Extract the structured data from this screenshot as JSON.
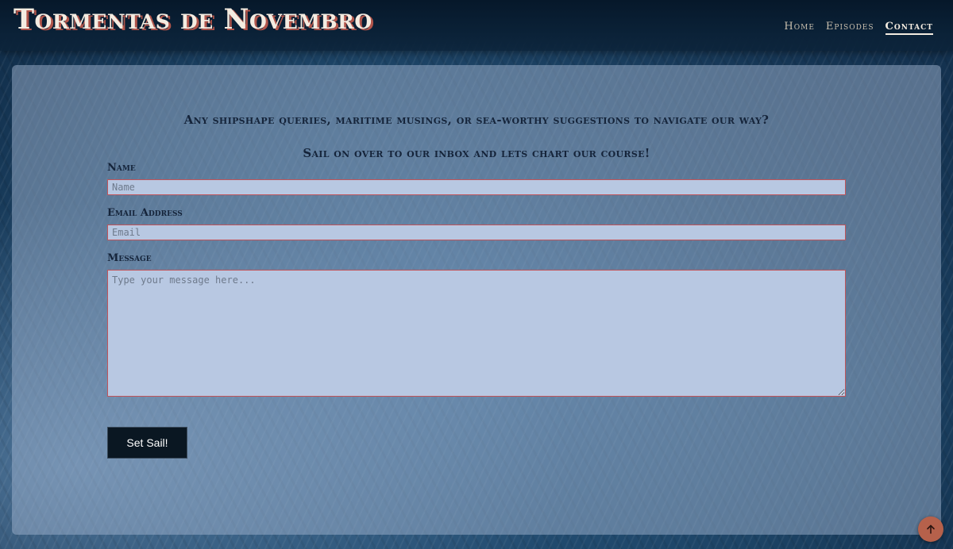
{
  "header": {
    "site_title": "Tormentas de Novembro",
    "nav": [
      {
        "label": "Home",
        "active": false
      },
      {
        "label": "Episodes",
        "active": false
      },
      {
        "label": "Contact",
        "active": true
      }
    ]
  },
  "contact": {
    "intro_line_1": "Any shipshape queries, maritime musings, or sea-worthy suggestions to navigate our way?",
    "intro_line_2": "Sail on over to our inbox and lets chart our course!",
    "fields": {
      "name": {
        "label": "Name",
        "placeholder": "Name",
        "value": ""
      },
      "email": {
        "label": "Email Address",
        "placeholder": "Email",
        "value": ""
      },
      "message": {
        "label": "Message",
        "placeholder": "Type your message here...",
        "value": ""
      }
    },
    "submit_label": "Set Sail!"
  },
  "back_to_top": {
    "icon": "arrow-up-icon"
  },
  "colors": {
    "header_bg": "#0b2238",
    "title_text": "#f4ece1",
    "title_shadow": "#b0544a",
    "input_bg": "#b8c8e2",
    "input_border": "#c0545a",
    "button_bg": "#0a1722",
    "back_to_top_bg": "#b6614b"
  }
}
